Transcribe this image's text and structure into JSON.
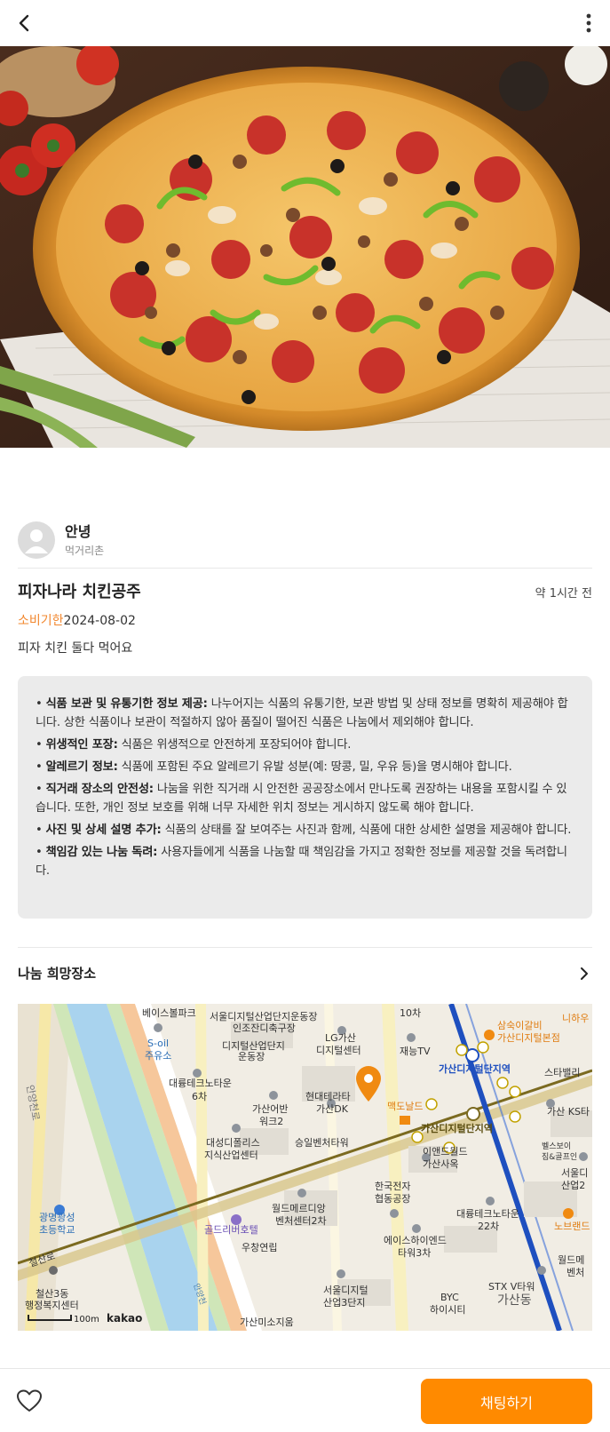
{
  "header": {
    "back_icon": "chevron-left-icon",
    "more_icon": "more-vertical-icon"
  },
  "hero": {
    "image": "pizza-photo"
  },
  "author": {
    "name": "안녕",
    "location": "먹거리촌"
  },
  "post": {
    "title": "피자나라 치킨공주",
    "time": "약 1시간 전",
    "expiry_label": "소비기한",
    "expiry_value": "2024-08-02",
    "description": "피자 치킨 둘다 먹어요"
  },
  "notice": {
    "items": [
      {
        "title": "식품 보관 및 유통기한 정보 제공:",
        "text": " 나누어지는 식품의 유통기한, 보관 방법 및 상태 정보를 명확히 제공해야 합니다. 상한 식품이나 보관이 적절하지 않아 품질이 떨어진 식품은 나눔에서 제외해야 합니다."
      },
      {
        "title": "위생적인 포장:",
        "text": " 식품은 위생적으로 안전하게 포장되어야 합니다."
      },
      {
        "title": "알레르기 정보:",
        "text": " 식품에 포함된 주요 알레르기 유발 성분(예: 땅콩, 밀, 우유 등)을 명시해야 합니다."
      },
      {
        "title": "직거래 장소의 안전성:",
        "text": " 나눔을 위한 직거래 시 안전한 공공장소에서 만나도록 권장하는 내용을 포함시킬 수 있습니다. 또한, 개인 정보 보호를 위해 너무 자세한 위치 정보는 게시하지 않도록 해야 합니다."
      },
      {
        "title": "사진 및 상세 설명 추가:",
        "text": " 식품의 상태를 잘 보여주는 사진과 함께, 식품에 대한 상세한 설명을 제공해야 합니다."
      },
      {
        "title": "책임감 있는 나눔 독려:",
        "text": " 사용자들에게 식품을 나눔할 때 책임감을 가지고 정확한 정보를 제공할 것을 독려합니다."
      }
    ]
  },
  "location": {
    "section_title": "나눔 희망장소",
    "arrow_icon": "chevron-right-icon"
  },
  "map": {
    "labels": {
      "l1": "베이스볼파크",
      "l2": "서울디지털산업단지운동장",
      "l3": "인조잔디축구장",
      "l4": "10차",
      "l5": "삼숙이갈비",
      "l6": "가산디지털본점",
      "l7": "니하우",
      "l8": "S-oil",
      "l9": "주유소",
      "l10": "디지털산업단지",
      "l11": "운동장",
      "l12": "LG가산",
      "l13": "디지털센터",
      "l14": "재능TV",
      "l15": "가산디지털단지역",
      "l16": "스타밸리",
      "l17": "대륭테크노타운",
      "l18": "6차",
      "l19": "현대테라타",
      "l20": "가산DK",
      "l21": "맥도날드",
      "l22": "가산어반",
      "l23": "워크2",
      "l24": "가산 KS타",
      "l25": "가산디지털단지역",
      "l26": "대성디폴리스",
      "l27": "지식산업센터",
      "l28": "승일벤처타워",
      "l29": "이앤드월드",
      "l30": "가산사옥",
      "l31": "벨스보이",
      "l32": "짐&골프인",
      "l33": "서울디",
      "l34": "산업2",
      "l35": "한국전자",
      "l36": "협동공장",
      "l37": "광명광성",
      "l38": "초등학교",
      "l39": "월드메르디앙",
      "l40": "벤처센터2차",
      "l41": "골드리버호텔",
      "l42": "대륭테크노타운",
      "l43": "22차",
      "l44": "노브랜드",
      "l45": "우창연립",
      "l46": "에이스하이엔드",
      "l47": "타워3차",
      "l48": "월드메",
      "l49": "벤처",
      "l50": "철산로",
      "l51": "안양천로",
      "l52": "철산3동",
      "l53": "행정복지센터",
      "l54": "서울디지털",
      "l55": "산업3단지",
      "l56": "BYC",
      "l57": "하이시티",
      "l58": "STX V타워",
      "l59": "가산동",
      "l60": "가산미소지움",
      "l61": "안양천",
      "scale": "100m",
      "brand": "kakao"
    }
  },
  "bottom": {
    "like_icon": "heart-icon",
    "chat_label": "채팅하기"
  }
}
